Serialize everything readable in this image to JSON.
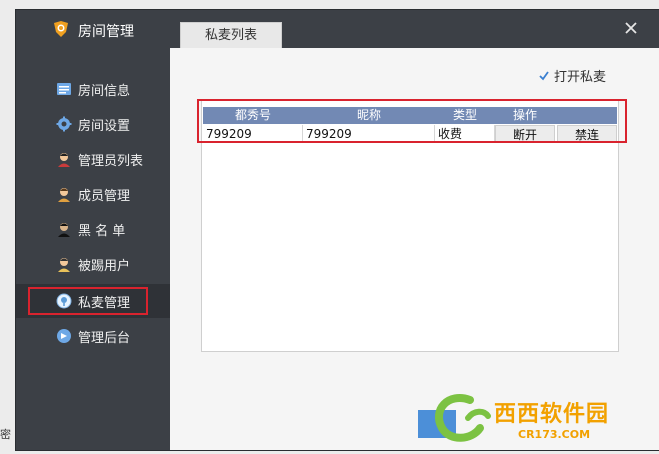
{
  "window": {
    "title": "房间管理",
    "close_label": "×"
  },
  "sidebar": {
    "items": [
      {
        "label": "房间信息",
        "icon": "info-list-icon"
      },
      {
        "label": "房间设置",
        "icon": "gear-icon"
      },
      {
        "label": "管理员列表",
        "icon": "admin-user-icon"
      },
      {
        "label": "成员管理",
        "icon": "member-user-icon"
      },
      {
        "label": "黑 名 单",
        "icon": "blacklist-user-icon"
      },
      {
        "label": "被踢用户",
        "icon": "kicked-user-icon"
      },
      {
        "label": "私麦管理",
        "icon": "private-mic-icon",
        "active": true
      },
      {
        "label": "管理后台",
        "icon": "backend-icon"
      }
    ]
  },
  "main": {
    "tab_label": "私麦列表",
    "checkbox": {
      "label": "打开私麦",
      "checked": true
    },
    "table": {
      "columns": [
        "都秀号",
        "昵称",
        "类型",
        "操作"
      ],
      "rows": [
        {
          "id": "799209",
          "nickname": "799209",
          "type": "收费",
          "actions": [
            "断开",
            "禁连"
          ]
        }
      ]
    }
  },
  "watermark": {
    "text": "西西软件园",
    "sub": "CR173.COM"
  },
  "left_peek_text": "密"
}
